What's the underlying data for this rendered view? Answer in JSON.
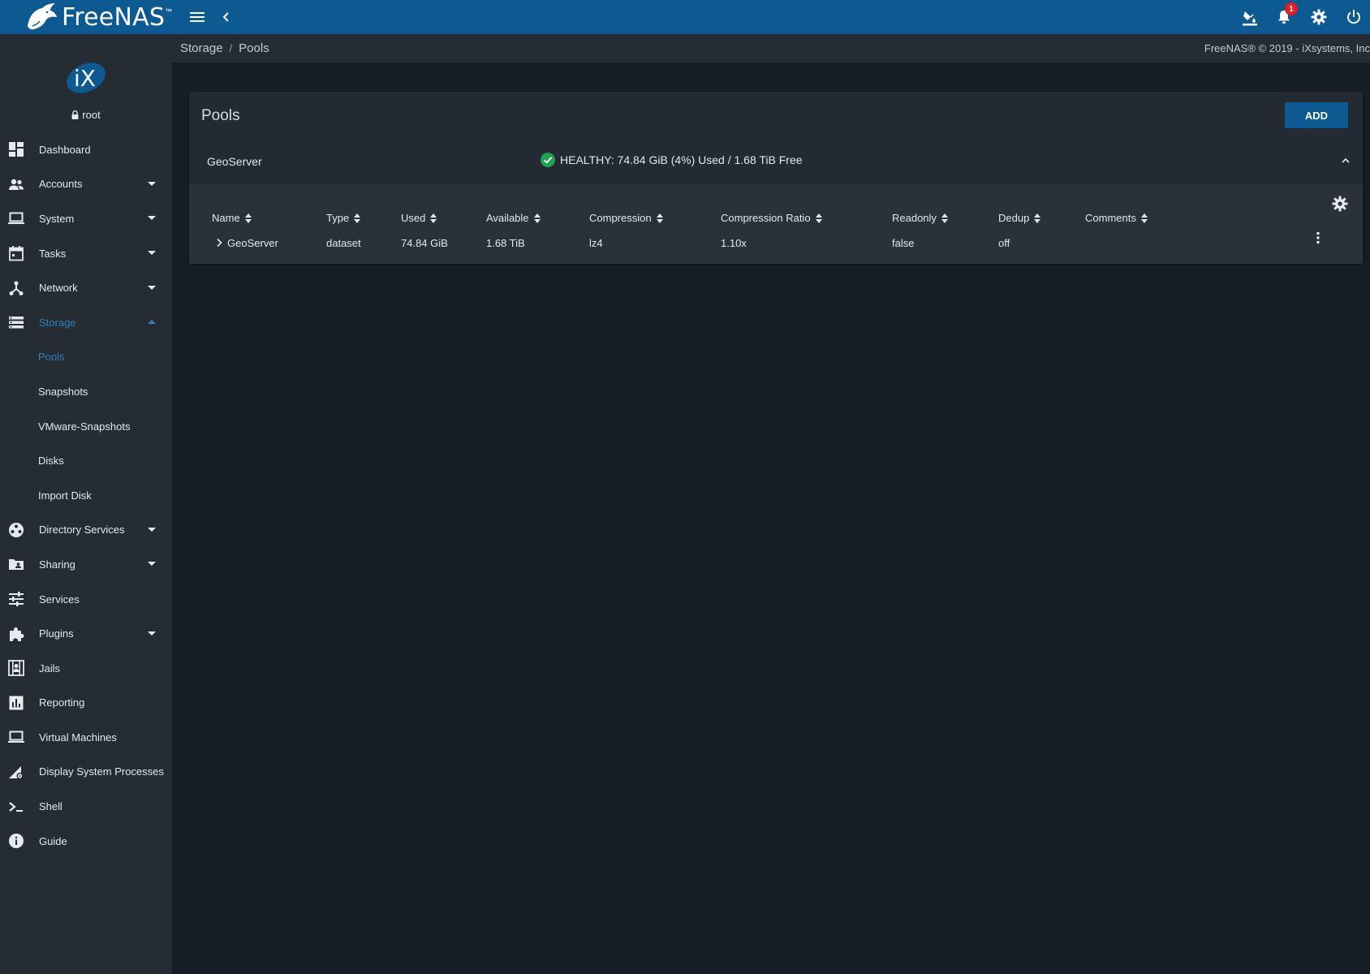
{
  "app": {
    "logo_text": "FreeNAS",
    "logo_tm": "™"
  },
  "topbar": {
    "notifications_count": "1",
    "icons": [
      "menu-icon",
      "chevron-left-icon",
      "theme-icon",
      "notifications-icon",
      "settings-icon",
      "power-icon"
    ]
  },
  "sidebar": {
    "user": "root",
    "items": [
      {
        "label": "Dashboard",
        "icon": "dashboard-icon"
      },
      {
        "label": "Accounts",
        "icon": "accounts-icon"
      },
      {
        "label": "System",
        "icon": "system-icon"
      },
      {
        "label": "Tasks",
        "icon": "tasks-icon"
      },
      {
        "label": "Network",
        "icon": "network-icon"
      },
      {
        "label": "Storage",
        "icon": "storage-icon"
      },
      {
        "label": "Pools"
      },
      {
        "label": "Snapshots"
      },
      {
        "label": "VMware-Snapshots"
      },
      {
        "label": "Disks"
      },
      {
        "label": "Import Disk"
      },
      {
        "label": "Directory Services",
        "icon": "directory-services-icon"
      },
      {
        "label": "Sharing",
        "icon": "sharing-icon"
      },
      {
        "label": "Services",
        "icon": "services-icon"
      },
      {
        "label": "Plugins",
        "icon": "plugins-icon"
      },
      {
        "label": "Jails",
        "icon": "jails-icon"
      },
      {
        "label": "Reporting",
        "icon": "reporting-icon"
      },
      {
        "label": "Virtual Machines",
        "icon": "virtual-machines-icon"
      },
      {
        "label": "Display System Processes",
        "icon": "display-system-processes-icon"
      },
      {
        "label": "Shell",
        "icon": "shell-icon"
      },
      {
        "label": "Guide",
        "icon": "guide-icon"
      }
    ]
  },
  "breadcrumb": {
    "parent": "Storage",
    "separator": "/",
    "current": "Pools"
  },
  "copyright": "FreeNAS® © 2019 - iXsystems, Inc",
  "pools": {
    "title": "Pools",
    "add_label": "ADD",
    "pool": {
      "name": "GeoServer",
      "status": "HEALTHY: 74.84 GiB (4%) Used / 1.68 TiB Free"
    },
    "columns": [
      "Name",
      "Type",
      "Used",
      "Available",
      "Compression",
      "Compression Ratio",
      "Readonly",
      "Dedup",
      "Comments"
    ],
    "rows": [
      [
        "GeoServer",
        "dataset",
        "74.84 GiB",
        "1.68 TiB",
        "lz4",
        "1.10x",
        "false",
        "off",
        ""
      ]
    ]
  },
  "colors": {
    "accent": "#0d5a93",
    "active": "#2f7fbd",
    "healthy": "#1ea350"
  }
}
